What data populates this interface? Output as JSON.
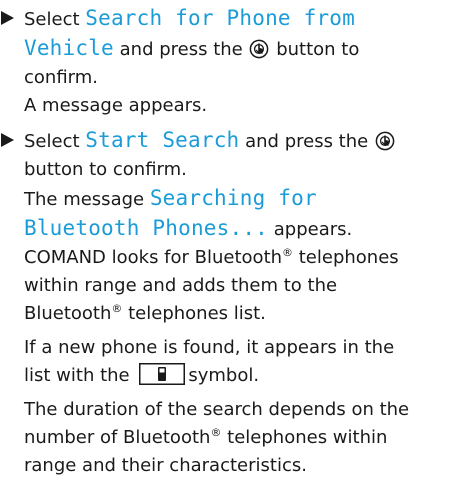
{
  "steps": [
    {
      "before": "Select ",
      "display_line1": "Search for Phone from",
      "display_line2": "Vehicle",
      "after_display": " and press the ",
      "after_button_line1": " button to",
      "after_button_line2": "confirm.",
      "result": "A message appears."
    },
    {
      "before": "Select ",
      "display": "Start Search",
      "after_display": " and press the ",
      "after_button_line1": "button to confirm.",
      "msg_before": "The message ",
      "msg_display_line1": "Searching for",
      "msg_display_line2": "Bluetooth Phones...",
      "msg_after": " appears.",
      "comand_line1_a": "COMAND looks for Bluetooth",
      "comand_line1_reg": "®",
      "comand_line1_b": " telephones",
      "comand_line2": "within range and adds them to the",
      "comand_line3_a": "Bluetooth",
      "comand_line3_reg": "®",
      "comand_line3_b": " telephones list.",
      "found_line1": "If a new phone is found, it appears in the",
      "found_line2_a": "list with the ",
      "found_line2_b": "symbol.",
      "duration_line1": "The duration of the search depends on the",
      "duration_line2_a": "number of Bluetooth",
      "duration_line2_reg": "®",
      "duration_line2_b": " telephones within",
      "duration_line3": "range and their characteristics."
    }
  ],
  "icons": {
    "bullet": "triangle-right-icon",
    "controller": "controller-knob-icon",
    "phone": "mobile-phone-icon"
  },
  "colors": {
    "text": "#1a1a1a",
    "display": "#1b9cd8"
  }
}
